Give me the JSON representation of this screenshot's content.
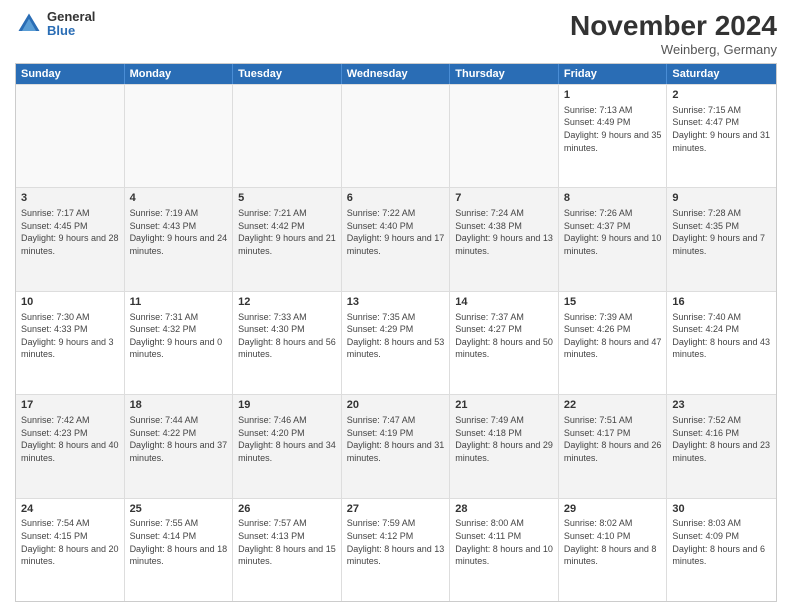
{
  "header": {
    "logo_general": "General",
    "logo_blue": "Blue",
    "month_title": "November 2024",
    "location": "Weinberg, Germany"
  },
  "days_of_week": [
    "Sunday",
    "Monday",
    "Tuesday",
    "Wednesday",
    "Thursday",
    "Friday",
    "Saturday"
  ],
  "weeks": [
    [
      {
        "day": "",
        "info": ""
      },
      {
        "day": "",
        "info": ""
      },
      {
        "day": "",
        "info": ""
      },
      {
        "day": "",
        "info": ""
      },
      {
        "day": "",
        "info": ""
      },
      {
        "day": "1",
        "info": "Sunrise: 7:13 AM\nSunset: 4:49 PM\nDaylight: 9 hours and 35 minutes."
      },
      {
        "day": "2",
        "info": "Sunrise: 7:15 AM\nSunset: 4:47 PM\nDaylight: 9 hours and 31 minutes."
      }
    ],
    [
      {
        "day": "3",
        "info": "Sunrise: 7:17 AM\nSunset: 4:45 PM\nDaylight: 9 hours and 28 minutes."
      },
      {
        "day": "4",
        "info": "Sunrise: 7:19 AM\nSunset: 4:43 PM\nDaylight: 9 hours and 24 minutes."
      },
      {
        "day": "5",
        "info": "Sunrise: 7:21 AM\nSunset: 4:42 PM\nDaylight: 9 hours and 21 minutes."
      },
      {
        "day": "6",
        "info": "Sunrise: 7:22 AM\nSunset: 4:40 PM\nDaylight: 9 hours and 17 minutes."
      },
      {
        "day": "7",
        "info": "Sunrise: 7:24 AM\nSunset: 4:38 PM\nDaylight: 9 hours and 13 minutes."
      },
      {
        "day": "8",
        "info": "Sunrise: 7:26 AM\nSunset: 4:37 PM\nDaylight: 9 hours and 10 minutes."
      },
      {
        "day": "9",
        "info": "Sunrise: 7:28 AM\nSunset: 4:35 PM\nDaylight: 9 hours and 7 minutes."
      }
    ],
    [
      {
        "day": "10",
        "info": "Sunrise: 7:30 AM\nSunset: 4:33 PM\nDaylight: 9 hours and 3 minutes."
      },
      {
        "day": "11",
        "info": "Sunrise: 7:31 AM\nSunset: 4:32 PM\nDaylight: 9 hours and 0 minutes."
      },
      {
        "day": "12",
        "info": "Sunrise: 7:33 AM\nSunset: 4:30 PM\nDaylight: 8 hours and 56 minutes."
      },
      {
        "day": "13",
        "info": "Sunrise: 7:35 AM\nSunset: 4:29 PM\nDaylight: 8 hours and 53 minutes."
      },
      {
        "day": "14",
        "info": "Sunrise: 7:37 AM\nSunset: 4:27 PM\nDaylight: 8 hours and 50 minutes."
      },
      {
        "day": "15",
        "info": "Sunrise: 7:39 AM\nSunset: 4:26 PM\nDaylight: 8 hours and 47 minutes."
      },
      {
        "day": "16",
        "info": "Sunrise: 7:40 AM\nSunset: 4:24 PM\nDaylight: 8 hours and 43 minutes."
      }
    ],
    [
      {
        "day": "17",
        "info": "Sunrise: 7:42 AM\nSunset: 4:23 PM\nDaylight: 8 hours and 40 minutes."
      },
      {
        "day": "18",
        "info": "Sunrise: 7:44 AM\nSunset: 4:22 PM\nDaylight: 8 hours and 37 minutes."
      },
      {
        "day": "19",
        "info": "Sunrise: 7:46 AM\nSunset: 4:20 PM\nDaylight: 8 hours and 34 minutes."
      },
      {
        "day": "20",
        "info": "Sunrise: 7:47 AM\nSunset: 4:19 PM\nDaylight: 8 hours and 31 minutes."
      },
      {
        "day": "21",
        "info": "Sunrise: 7:49 AM\nSunset: 4:18 PM\nDaylight: 8 hours and 29 minutes."
      },
      {
        "day": "22",
        "info": "Sunrise: 7:51 AM\nSunset: 4:17 PM\nDaylight: 8 hours and 26 minutes."
      },
      {
        "day": "23",
        "info": "Sunrise: 7:52 AM\nSunset: 4:16 PM\nDaylight: 8 hours and 23 minutes."
      }
    ],
    [
      {
        "day": "24",
        "info": "Sunrise: 7:54 AM\nSunset: 4:15 PM\nDaylight: 8 hours and 20 minutes."
      },
      {
        "day": "25",
        "info": "Sunrise: 7:55 AM\nSunset: 4:14 PM\nDaylight: 8 hours and 18 minutes."
      },
      {
        "day": "26",
        "info": "Sunrise: 7:57 AM\nSunset: 4:13 PM\nDaylight: 8 hours and 15 minutes."
      },
      {
        "day": "27",
        "info": "Sunrise: 7:59 AM\nSunset: 4:12 PM\nDaylight: 8 hours and 13 minutes."
      },
      {
        "day": "28",
        "info": "Sunrise: 8:00 AM\nSunset: 4:11 PM\nDaylight: 8 hours and 10 minutes."
      },
      {
        "day": "29",
        "info": "Sunrise: 8:02 AM\nSunset: 4:10 PM\nDaylight: 8 hours and 8 minutes."
      },
      {
        "day": "30",
        "info": "Sunrise: 8:03 AM\nSunset: 4:09 PM\nDaylight: 8 hours and 6 minutes."
      }
    ]
  ]
}
